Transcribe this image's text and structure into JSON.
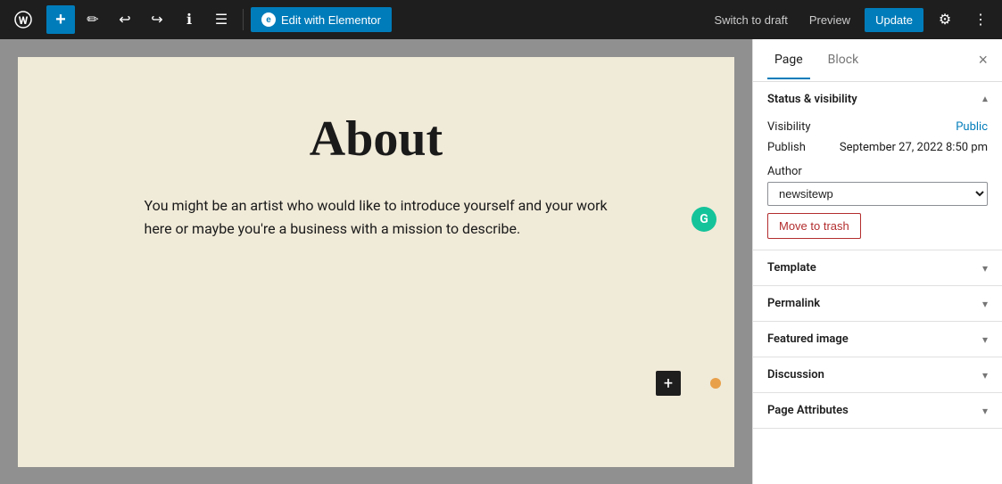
{
  "toolbar": {
    "wp_logo": "W",
    "add_label": "+",
    "pencil_icon": "✏",
    "undo_icon": "↩",
    "redo_icon": "↪",
    "info_icon": "ℹ",
    "list_icon": "☰",
    "elementor_btn_label": "Edit with Elementor",
    "elementor_icon": "e",
    "switch_draft_label": "Switch to draft",
    "preview_label": "Preview",
    "update_label": "Update",
    "settings_icon": "⚙",
    "more_icon": "⋮"
  },
  "canvas": {
    "page_title": "About",
    "page_body": "You might be an artist who would like to introduce yourself and your work here or maybe you're a business with a mission to describe.",
    "grammarly_label": "G",
    "add_block_label": "+",
    "orange_dot": ""
  },
  "sidebar": {
    "tab_page_label": "Page",
    "tab_block_label": "Block",
    "close_label": "×",
    "sections": [
      {
        "id": "status-visibility",
        "title": "Status & visibility",
        "expanded": true,
        "visibility_label": "Visibility",
        "visibility_value": "Public",
        "publish_label": "Publish",
        "publish_value": "September 27, 2022 8:50 pm",
        "author_label": "Author",
        "author_value": "newsitewp",
        "move_to_trash_label": "Move to trash"
      },
      {
        "id": "template",
        "title": "Template",
        "expanded": false
      },
      {
        "id": "permalink",
        "title": "Permalink",
        "expanded": false
      },
      {
        "id": "featured-image",
        "title": "Featured image",
        "expanded": false
      },
      {
        "id": "discussion",
        "title": "Discussion",
        "expanded": false
      },
      {
        "id": "page-attributes",
        "title": "Page Attributes",
        "expanded": false
      }
    ]
  }
}
